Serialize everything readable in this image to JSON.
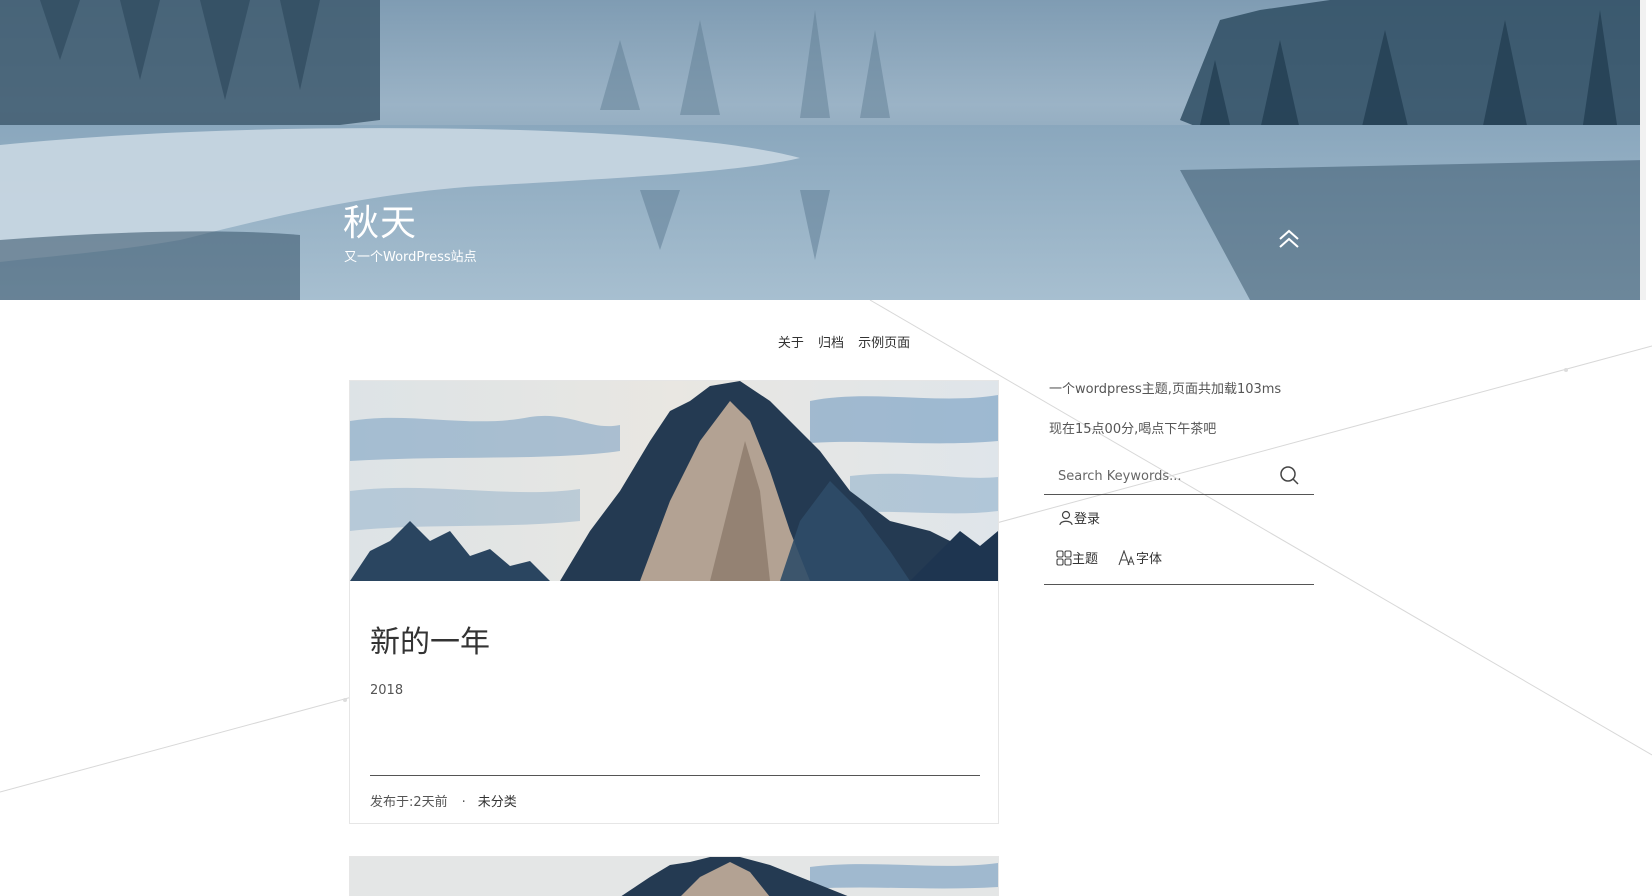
{
  "header": {
    "site_title": "秋天",
    "site_description": "又一个WordPress站点"
  },
  "nav": {
    "items": [
      {
        "label": "关于"
      },
      {
        "label": "归档"
      },
      {
        "label": "示例页面"
      }
    ]
  },
  "posts": [
    {
      "title": "新的一年",
      "excerpt": "2018",
      "meta_prefix": "发布于:2天前",
      "meta_separator": "·",
      "category": "未分类"
    }
  ],
  "sidebar": {
    "load_info": "一个wordpress主题,页面共加载103ms",
    "time_info": "现在15点00分,喝点下午茶吧",
    "search": {
      "placeholder": "Search Keywords..."
    },
    "login_label": "登录",
    "theme_label": "主题",
    "font_label": "字体"
  },
  "icons": [
    "chevron-up-double-icon",
    "search-icon",
    "user-icon",
    "grid-icon",
    "font-icon"
  ],
  "colors": {
    "text": "#333333",
    "rule": "#555555",
    "card_border": "#e6e6e6"
  }
}
